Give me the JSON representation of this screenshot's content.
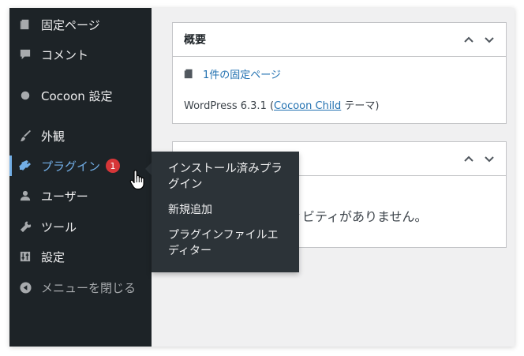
{
  "sidebar": {
    "items": [
      {
        "id": "pages",
        "label": "固定ページ",
        "icon": "page-icon"
      },
      {
        "id": "comments",
        "label": "コメント",
        "icon": "comment-icon"
      },
      {
        "id": "cocoon",
        "label": "Cocoon 設定",
        "icon": "circle-icon"
      },
      {
        "id": "appearance",
        "label": "外観",
        "icon": "brush-icon"
      },
      {
        "id": "plugins",
        "label": "プラグイン",
        "icon": "plugin-icon",
        "badge": "1",
        "current": true
      },
      {
        "id": "users",
        "label": "ユーザー",
        "icon": "user-icon"
      },
      {
        "id": "tools",
        "label": "ツール",
        "icon": "wrench-icon"
      },
      {
        "id": "settings",
        "label": "設定",
        "icon": "settings-icon"
      },
      {
        "id": "collapse",
        "label": "メニューを閉じる",
        "icon": "collapse-icon"
      }
    ]
  },
  "flyout": {
    "items": [
      {
        "label": "インストール済みプラグイン"
      },
      {
        "label": "新規追加"
      },
      {
        "label": "プラグインファイルエディター"
      }
    ]
  },
  "glance": {
    "title": "概要",
    "pages_link": "1件の固定ページ",
    "wp_prefix": "WordPress 6.3.1 (",
    "theme_link": "Cocoon Child",
    "wp_suffix": " テーマ)"
  },
  "activity": {
    "text": "ィビティがありません。"
  },
  "colors": {
    "sidebar_bg": "#1d2327",
    "flyout_bg": "#2c3338",
    "accent": "#72aee6",
    "badge": "#d63638",
    "link": "#2271b1"
  }
}
